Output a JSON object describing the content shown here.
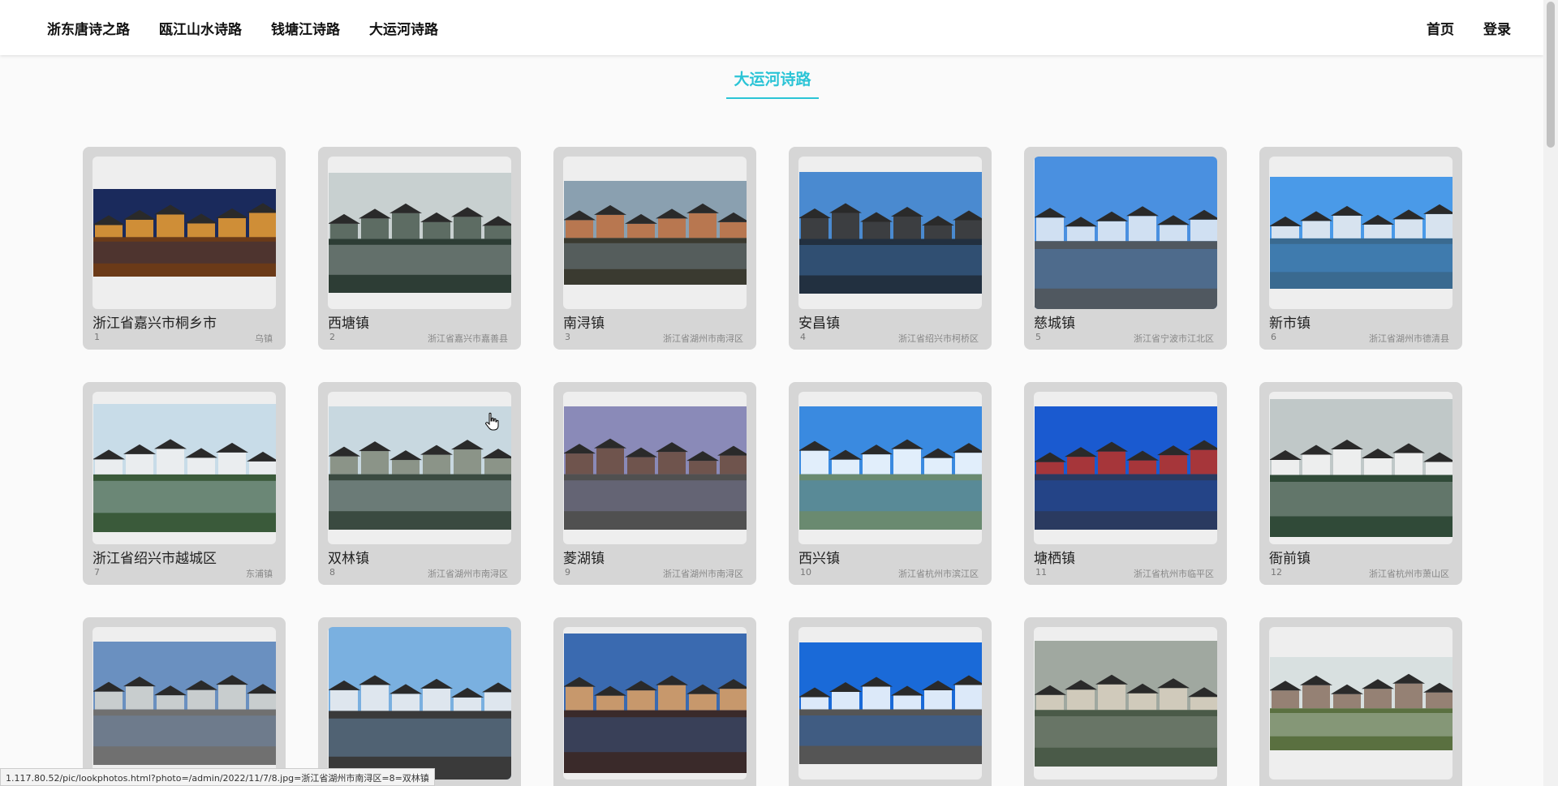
{
  "nav": {
    "left": [
      "浙东唐诗之路",
      "瓯江山水诗路",
      "钱塘江诗路",
      "大运河诗路"
    ],
    "right": [
      "首页",
      "登录"
    ]
  },
  "section_title": "大运河诗路",
  "cards": [
    {
      "title": "浙江省嘉兴市桐乡市",
      "num": "1",
      "loc": "乌镇"
    },
    {
      "title": "西塘镇",
      "num": "2",
      "loc": "浙江省嘉兴市嘉善县"
    },
    {
      "title": "南浔镇",
      "num": "3",
      "loc": "浙江省湖州市南浔区"
    },
    {
      "title": "安昌镇",
      "num": "4",
      "loc": "浙江省绍兴市柯桥区"
    },
    {
      "title": "慈城镇",
      "num": "5",
      "loc": "浙江省宁波市江北区"
    },
    {
      "title": "新市镇",
      "num": "6",
      "loc": "浙江省湖州市德清县"
    },
    {
      "title": "浙江省绍兴市越城区",
      "num": "7",
      "loc": "东浦镇"
    },
    {
      "title": "双林镇",
      "num": "8",
      "loc": "浙江省湖州市南浔区"
    },
    {
      "title": "菱湖镇",
      "num": "9",
      "loc": "浙江省湖州市南浔区"
    },
    {
      "title": "西兴镇",
      "num": "10",
      "loc": "浙江省杭州市滨江区"
    },
    {
      "title": "塘栖镇",
      "num": "11",
      "loc": "浙江省杭州市临平区"
    },
    {
      "title": "衙前镇",
      "num": "12",
      "loc": "浙江省杭州市萧山区"
    },
    {
      "title": "",
      "num": "",
      "loc": ""
    },
    {
      "title": "",
      "num": "",
      "loc": ""
    },
    {
      "title": "",
      "num": "",
      "loc": ""
    },
    {
      "title": "",
      "num": "",
      "loc": ""
    },
    {
      "title": "",
      "num": "",
      "loc": ""
    },
    {
      "title": "",
      "num": "",
      "loc": ""
    }
  ],
  "status_url": "1.117.80.52/pic/lookphotos.html?photo=/admin/2022/11/7/8.jpg=浙江省湖州市南浔区=8=双林镇"
}
